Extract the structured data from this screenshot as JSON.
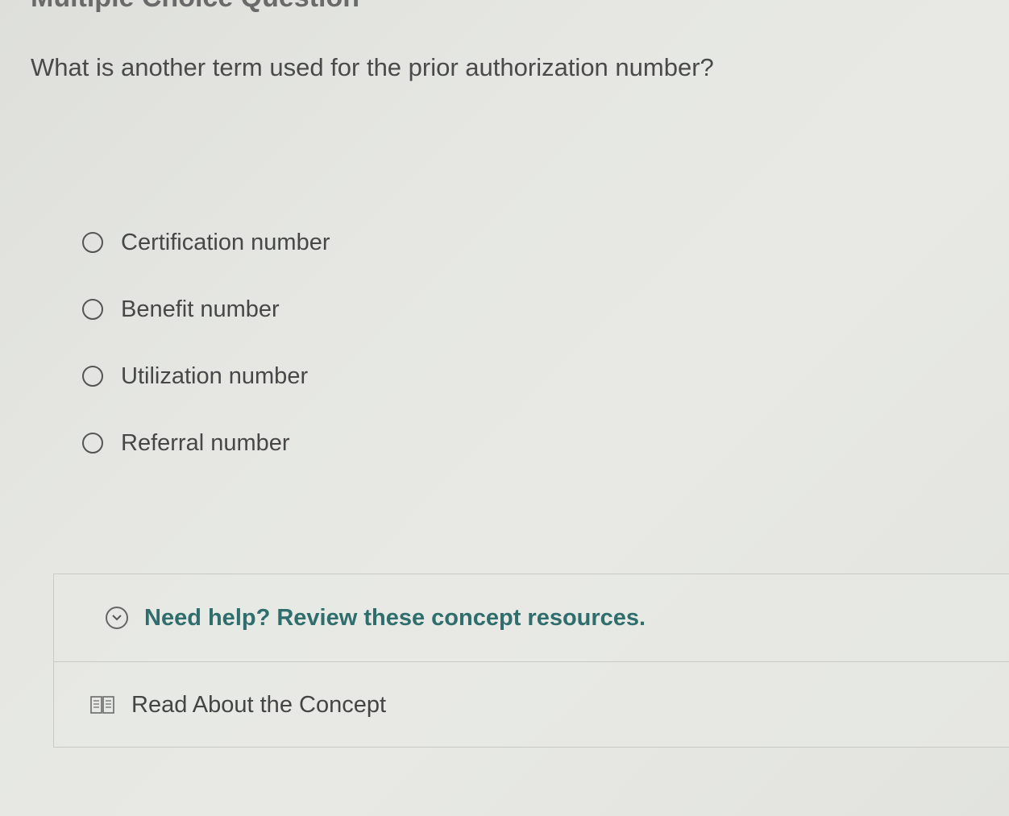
{
  "header": {
    "title": "Multiple Choice Question"
  },
  "question": {
    "text": "What is another term used for the prior authorization number?"
  },
  "options": [
    {
      "label": "Certification number",
      "selected": false
    },
    {
      "label": "Benefit number",
      "selected": false
    },
    {
      "label": "Utilization number",
      "selected": false
    },
    {
      "label": "Referral number",
      "selected": false
    }
  ],
  "help": {
    "title": "Need help? Review these concept resources.",
    "resources": [
      {
        "label": "Read About the Concept",
        "icon": "book-icon"
      }
    ]
  },
  "colors": {
    "accent": "#2f6e6c",
    "text": "#474747",
    "border": "#c9cac6",
    "background": "#e6e7e3"
  }
}
